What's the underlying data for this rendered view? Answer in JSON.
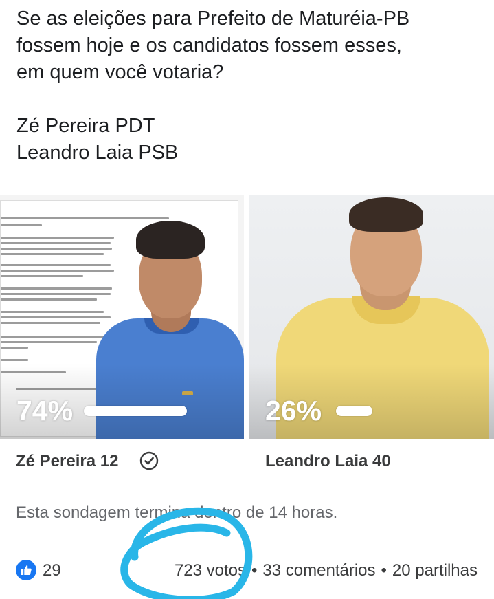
{
  "post": {
    "question_lines": [
      "Se as eleições para Prefeito de Maturéia-PB",
      "fossem hoje e os candidatos fossem esses,",
      "em quem você votaria?"
    ],
    "candidate_lines": [
      "Zé Pereira PDT",
      "Leandro Laia PSB"
    ]
  },
  "poll": {
    "options": [
      {
        "label": "Zé Pereira 12",
        "percent_text": "74%",
        "percent": 74,
        "selected": true,
        "shirt_color": "#4a7fd0"
      },
      {
        "label": "Leandro Laia 40",
        "percent_text": "26%",
        "percent": 26,
        "selected": false,
        "shirt_color": "#f0d878"
      }
    ],
    "status": "Esta sondagem termina dentro de 14 horas.",
    "selected_icon": "check-circle-icon"
  },
  "footer": {
    "reaction_icon": "like-icon",
    "reaction_count": "29",
    "votes": "723 votos",
    "comments": "33 comentários",
    "shares": "20 partilhas",
    "separator": "•"
  },
  "colors": {
    "like_blue": "#1877f2",
    "text_primary": "#1c1e21",
    "text_secondary": "#65676b",
    "scribble": "#29b6e8"
  }
}
